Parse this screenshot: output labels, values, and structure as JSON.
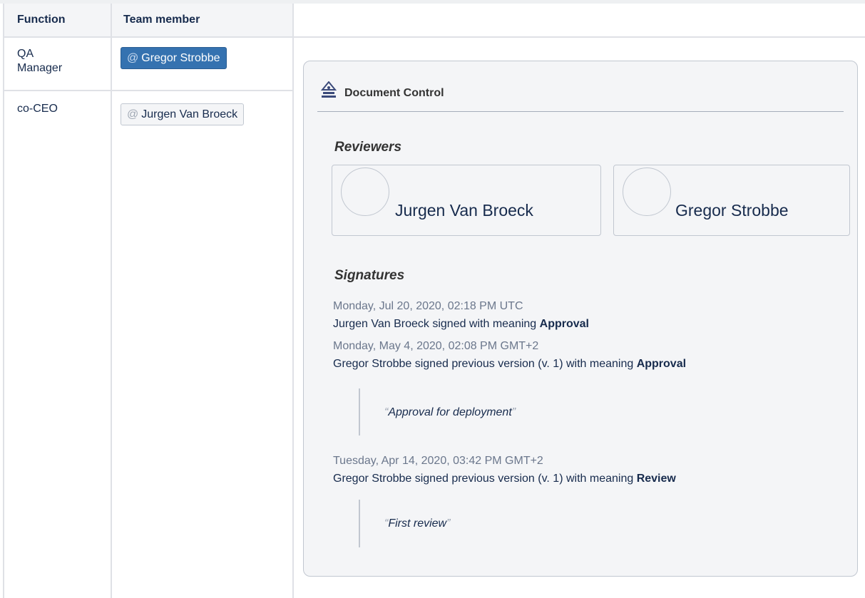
{
  "table": {
    "headers": [
      "Function",
      "Team member"
    ],
    "rows": [
      {
        "function": "QA Manager",
        "function_line1": "QA",
        "function_line2": "Manager",
        "member": "Gregor Strobbe",
        "member_is_current_user": true
      },
      {
        "function": "co-CEO",
        "member": "Jurgen Van Broeck",
        "member_is_current_user": false
      }
    ],
    "mention_prefix": "@"
  },
  "document_control": {
    "icon": "document-control-icon",
    "title": "Document Control",
    "reviewers_heading": "Reviewers",
    "reviewers": [
      {
        "name": "Jurgen Van Broeck"
      },
      {
        "name": "Gregor Strobbe"
      }
    ],
    "signatures_heading": "Signatures",
    "signatures": [
      {
        "date": "Monday, Jul 20, 2020, 02:18 PM UTC",
        "signer": "Jurgen Van Broeck",
        "middle": " signed with meaning ",
        "meaning": "Approval",
        "comment": ""
      },
      {
        "date": "Monday, May 4, 2020, 02:08 PM GMT+2",
        "signer": "Gregor Strobbe",
        "middle": " signed previous version (v. 1) with meaning ",
        "meaning": "Approval",
        "comment": "Approval for deployment"
      },
      {
        "date": "Tuesday, Apr 14, 2020, 03:42 PM GMT+2",
        "signer": "Gregor Strobbe",
        "middle": " signed previous version (v. 1) with meaning ",
        "meaning": "Review",
        "comment": "First review"
      }
    ],
    "quote_open": "“",
    "quote_close": "”"
  },
  "colors": {
    "mention_current_bg": "#3572b0",
    "panel_bg": "#f4f5f7",
    "border": "#c1c7d0"
  }
}
